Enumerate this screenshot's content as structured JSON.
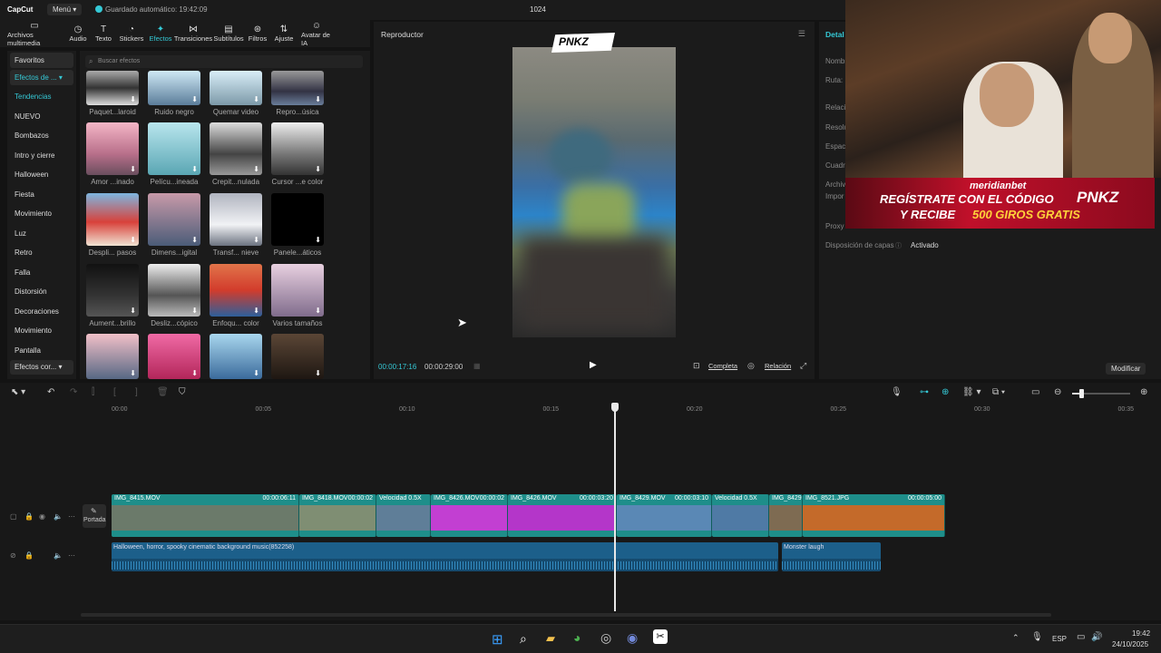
{
  "titlebar": {
    "app": "CapCut",
    "menu": "Menú",
    "autosave": "Guardado automático: 19:42:09",
    "project": "1024"
  },
  "toolbar": [
    {
      "label": "Archivos multimedia",
      "icon": "▭"
    },
    {
      "label": "Audio",
      "icon": "◷"
    },
    {
      "label": "Texto",
      "icon": "T"
    },
    {
      "label": "Stickers",
      "icon": "◔"
    },
    {
      "label": "Efectos",
      "icon": "✦"
    },
    {
      "label": "Transiciones",
      "icon": "⋈"
    },
    {
      "label": "Subtítulos",
      "icon": "▤"
    },
    {
      "label": "Filtros",
      "icon": "⊛"
    },
    {
      "label": "Ajuste",
      "icon": "⇅"
    },
    {
      "label": "Avatar de IA",
      "icon": "☺"
    }
  ],
  "categories": [
    "Favoritos",
    "Efectos de ...",
    "Tendencias",
    "NUEVO",
    "Bombazos",
    "Intro y cierre",
    "Halloween",
    "Fiesta",
    "Movimiento",
    "Luz",
    "Retro",
    "Falla",
    "Distorsión",
    "Decoraciones",
    "Movimiento",
    "Pantalla"
  ],
  "categories_bottom": "Efectos cor...",
  "search_placeholder": "Buscar efectos",
  "effects": [
    "Paquet...laroid",
    "Ruido negro",
    "Quemar video",
    "Repro...úsica",
    "Amor ...inado",
    "Pelícu...ineada",
    "Crepit...nulada",
    "Cursor ...e color",
    "Despli... pasos",
    "Dimens...igital",
    "Transf... nieve",
    "Panele...áticos",
    "Aument...brillo",
    "Desliz...cópico",
    "Enfoqu... color",
    "Varios tamaños",
    "",
    "",
    "",
    ""
  ],
  "player": {
    "title": "Reproductor",
    "logo": "PNKZ",
    "current": "00:00:17:16",
    "total": "00:00:29:00",
    "full": "Completa",
    "ratio": "Relación"
  },
  "details": {
    "title": "Detal",
    "fields": [
      "Nombr",
      "Ruta:",
      "Relaci",
      "Resolu",
      "Espac",
      "Cuadr",
      "Archiv",
      "Impor",
      "Proxy"
    ],
    "layers_label": "Disposición de capas",
    "layers_value": "Activado",
    "modify": "Modificar"
  },
  "overlay": {
    "brand": "meridianbet",
    "line1": "REGÍSTRATE CON EL CÓDIGO",
    "code": "PNKZ",
    "line2a": "Y RECIBE",
    "line2b": "500 GIROS GRATIS"
  },
  "ruler": [
    "00:00",
    "00:05",
    "00:10",
    "00:15",
    "00:20",
    "00:25",
    "00:30",
    "00:35"
  ],
  "cover_label": "Portada",
  "clips": [
    {
      "name": "IMG_8415.MOV",
      "dur": "00:00:06:11"
    },
    {
      "name": "IMG_8418.MOV",
      "dur": "00:00:02"
    },
    {
      "name": "Velocidad 0.5X",
      "dur": ""
    },
    {
      "name": "IMG_8426.MOV",
      "dur": "00:00:02"
    },
    {
      "name": "IMG_8426.MOV",
      "dur": "00:00:03:20"
    },
    {
      "name": "IMG_8429.MOV",
      "dur": "00:00:03:10"
    },
    {
      "name": "Velocidad 0.5X",
      "dur": ""
    },
    {
      "name": "IMG_8429",
      "dur": ""
    },
    {
      "name": "IMG_8521.JPG",
      "dur": "00:00:05:00"
    }
  ],
  "audio": [
    {
      "name": "Halloween, horror, spooky cinematic background music(852258)"
    },
    {
      "name": "Monster laugh"
    }
  ],
  "taskbar": {
    "lang": "ESP",
    "time": "19:42",
    "date": "24/10/2025"
  },
  "colors": {
    "accent": "#35c9d6",
    "video_track": "#1e8e8a",
    "audio_track": "#1c5f8a"
  }
}
